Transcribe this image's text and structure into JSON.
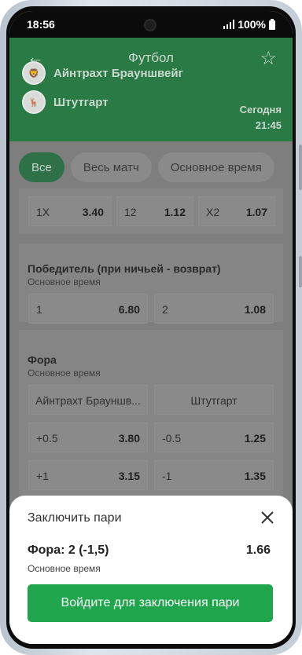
{
  "status_bar": {
    "time": "18:56",
    "battery": "100%"
  },
  "header": {
    "title": "Футбол",
    "home_team": "Айнтрахт Брауншвейг",
    "away_team": "Штутгарт",
    "date_label": "Сегодня",
    "time_label": "21:45"
  },
  "filters": [
    "Все",
    "Весь матч",
    "Основное время"
  ],
  "double_chance": [
    {
      "label": "1X",
      "odd": "3.40"
    },
    {
      "label": "12",
      "odd": "1.12"
    },
    {
      "label": "X2",
      "odd": "1.07"
    }
  ],
  "draw_no_bet": {
    "title": "Победитель (при ничьей - возврат)",
    "subtitle": "Основное время",
    "options": [
      {
        "label": "1",
        "odd": "6.80"
      },
      {
        "label": "2",
        "odd": "1.08"
      }
    ]
  },
  "handicap": {
    "title": "Фора",
    "subtitle": "Основное время",
    "home_header": "Айнтрахт Брауншв...",
    "away_header": "Штутгарт",
    "rows": [
      {
        "home_label": "+0.5",
        "home_odd": "3.80",
        "away_label": "-0.5",
        "away_odd": "1.25"
      },
      {
        "home_label": "+1",
        "home_odd": "3.15",
        "away_label": "-1",
        "away_odd": "1.35"
      }
    ]
  },
  "bet_sheet": {
    "title": "Заключить пари",
    "bet_label": "Фора: 2 (-1,5)",
    "odd": "1.66",
    "subtitle": "Основное время",
    "login_button": "Войдите для заключения пари"
  },
  "colors": {
    "brand_green": "#1fa54c",
    "header_green": "#2a7a46"
  }
}
